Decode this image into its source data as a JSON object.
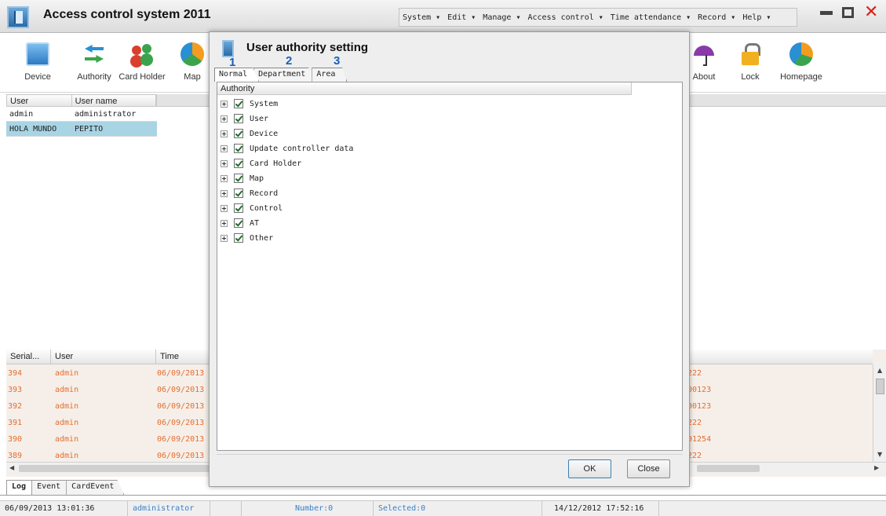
{
  "app": {
    "title": "Access control system 2011",
    "menu": [
      "System ▾",
      "Edit ▾",
      "Manage ▾",
      "Access control ▾",
      "Time attendance ▾",
      "Record ▾",
      "Help ▾"
    ]
  },
  "toolbar": {
    "left": [
      {
        "label": "Device",
        "icon": "device-icon"
      },
      {
        "label": "Authority",
        "icon": "authority-icon"
      },
      {
        "label": "Card Holder",
        "icon": "card-holder-icon"
      },
      {
        "label": "Map",
        "icon": "map-icon"
      }
    ],
    "right": [
      {
        "label": "About",
        "icon": "about-icon"
      },
      {
        "label": "Lock",
        "icon": "lock-icon"
      },
      {
        "label": "Homepage",
        "icon": "homepage-icon"
      }
    ]
  },
  "users": {
    "columns": [
      "User",
      "User name"
    ],
    "rows": [
      {
        "user": "admin",
        "name": "administrator"
      },
      {
        "user": "HOLA MUNDO",
        "name": "PEPITO"
      }
    ]
  },
  "log": {
    "columns": [
      "Serial...",
      "User",
      "Time"
    ],
    "rows": [
      {
        "serial": "394",
        "user": "admin",
        "time": "06/09/2013",
        "tail": "222"
      },
      {
        "serial": "393",
        "user": "admin",
        "time": "06/09/2013",
        "tail": "00123"
      },
      {
        "serial": "392",
        "user": "admin",
        "time": "06/09/2013",
        "tail": "00123"
      },
      {
        "serial": "391",
        "user": "admin",
        "time": "06/09/2013",
        "tail": "222"
      },
      {
        "serial": "390",
        "user": "admin",
        "time": "06/09/2013",
        "tail": "01254"
      },
      {
        "serial": "389",
        "user": "admin",
        "time": "06/09/2013",
        "tail": "222"
      }
    ],
    "tabs": [
      "Log",
      "Event",
      "CardEvent"
    ]
  },
  "status": {
    "datetime": "06/09/2013 13:01:36",
    "user": "administrator",
    "number": "Number:0",
    "selected": "Selected:0",
    "date2": "14/12/2012 17:52:16"
  },
  "dialog": {
    "title": "User authority setting",
    "annotations": [
      "1",
      "2",
      "3"
    ],
    "tabs": [
      "Normal",
      "Department",
      "Area"
    ],
    "column_header": "Authority",
    "authorities": [
      "System",
      "User",
      "Device",
      "Update controller data",
      "Card Holder",
      "Map",
      "Record",
      "Control",
      "AT",
      "Other"
    ],
    "ok_label": "OK",
    "close_label": "Close"
  }
}
